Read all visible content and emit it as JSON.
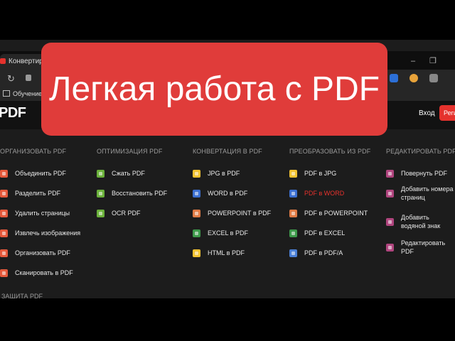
{
  "browser": {
    "tab_title": "Конвертиру",
    "bookmark_label": "Обучение",
    "window_min": "–",
    "window_max": "❐",
    "reload_glyph": "↻"
  },
  "site": {
    "logo": "PDF",
    "login_label": "Вход",
    "register_label": "Регистрация"
  },
  "menu": {
    "columns": [
      {
        "title": "ОРГАНИЗОВАТЬ PDF",
        "items": [
          {
            "label": "Объединить PDF",
            "icon": "merge-icon",
            "color": "#e5593b"
          },
          {
            "label": "Разделить PDF",
            "icon": "split-icon",
            "color": "#e5593b"
          },
          {
            "label": "Удалить страницы",
            "icon": "delete-pages-icon",
            "color": "#e5593b"
          },
          {
            "label": "Извлечь изображения",
            "icon": "extract-images-icon",
            "color": "#e5593b"
          },
          {
            "label": "Организовать PDF",
            "icon": "organize-icon",
            "color": "#e5593b"
          },
          {
            "label": "Сканировать в PDF",
            "icon": "scan-icon",
            "color": "#e5593b"
          }
        ]
      },
      {
        "title": "ОПТИМИЗАЦИЯ PDF",
        "items": [
          {
            "label": "Сжать PDF",
            "icon": "compress-icon",
            "color": "#6bb13b"
          },
          {
            "label": "Восстановить PDF",
            "icon": "repair-icon",
            "color": "#6bb13b"
          },
          {
            "label": "OCR PDF",
            "icon": "ocr-icon",
            "color": "#6bb13b"
          }
        ]
      },
      {
        "title": "КОНВЕРТАЦИЯ В PDF",
        "items": [
          {
            "label": "JPG в PDF",
            "icon": "jpg-to-pdf-icon",
            "color": "#f2c230"
          },
          {
            "label": "WORD в PDF",
            "icon": "word-to-pdf-icon",
            "color": "#3b6fd1"
          },
          {
            "label": "POWERPOINT в PDF",
            "icon": "powerpoint-to-pdf-icon",
            "color": "#e07b45"
          },
          {
            "label": "EXCEL в PDF",
            "icon": "excel-to-pdf-icon",
            "color": "#3d9a4a"
          },
          {
            "label": "HTML в PDF",
            "icon": "html-to-pdf-icon",
            "color": "#f2c230"
          }
        ]
      },
      {
        "title": "ПРЕОБРАЗОВАТЬ ИЗ PDF",
        "items": [
          {
            "label": "PDF в JPG",
            "icon": "pdf-to-jpg-icon",
            "color": "#f2c230"
          },
          {
            "label": "PDF в WORD",
            "icon": "pdf-to-word-icon",
            "color": "#3b6fd1",
            "active": true
          },
          {
            "label": "PDF в POWERPOINT",
            "icon": "pdf-to-powerpoint-icon",
            "color": "#e07b45"
          },
          {
            "label": "PDF в EXCEL",
            "icon": "pdf-to-excel-icon",
            "color": "#3d9a4a"
          },
          {
            "label": "PDF в PDF/A",
            "icon": "pdf-to-pdfa-icon",
            "color": "#4a7fd6"
          }
        ]
      },
      {
        "title": "РЕДАКТИРОВАТЬ PDF",
        "items": [
          {
            "label": "Повернуть PDF",
            "icon": "rotate-icon",
            "color": "#b0457e"
          },
          {
            "label": "Добавить номера страниц",
            "icon": "page-numbers-icon",
            "color": "#b0457e"
          },
          {
            "label": "Добавить водяной знак",
            "icon": "watermark-icon",
            "color": "#b0457e"
          },
          {
            "label": "Редактировать PDF",
            "icon": "edit-icon",
            "color": "#b0457e"
          }
        ]
      }
    ],
    "security_title": "ЗАЩИТА PDF"
  },
  "overlay": {
    "title": "Легкая работа с PDF",
    "background": "#e03c3a"
  },
  "colors": {
    "brand_red": "#e5322d",
    "page_bg": "#1c1c1c"
  }
}
